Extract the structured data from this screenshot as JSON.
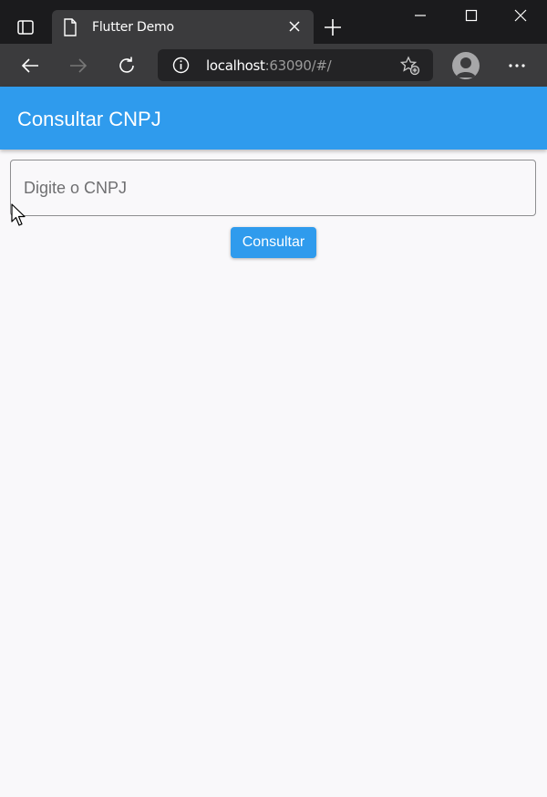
{
  "browser": {
    "tab_title": "Flutter Demo",
    "url_host": "localhost",
    "url_rest": ":63090/#/"
  },
  "app": {
    "title": "Consultar CNPJ",
    "cnpj_input": {
      "placeholder": "Digite o CNPJ",
      "value": ""
    },
    "submit_label": "Consultar"
  },
  "colors": {
    "primary": "#2f9bed",
    "background": "#f9f8fa",
    "browser_dark": "#1b1b1d",
    "browser_toolbar": "#3b3b3d"
  },
  "icons": [
    "tab-actions-icon",
    "page-icon",
    "close-icon",
    "plus-icon",
    "minimize-icon",
    "maximize-icon",
    "close-window-icon",
    "back-arrow-icon",
    "forward-arrow-icon",
    "reload-icon",
    "info-icon",
    "favorite-add-icon",
    "profile-icon",
    "more-icon",
    "mouse-cursor-icon"
  ]
}
